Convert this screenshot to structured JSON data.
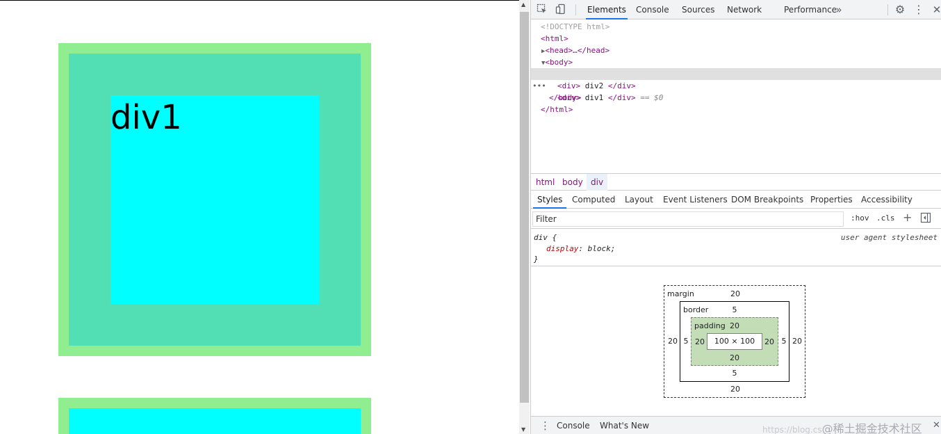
{
  "page": {
    "div1_text": "div1"
  },
  "devtools": {
    "tabs": [
      "Elements",
      "Console",
      "Sources",
      "Network",
      "Performance"
    ],
    "more_tabs_icon": "chevrons-right-icon",
    "elements_tree": {
      "doctype": "<!DOCTYPE html>",
      "html_open": "<html>",
      "head": "<head>…</head>",
      "body_open": "<body>",
      "div1_open": "<div>",
      "div1_text": " div1 ",
      "div1_close": "</div>",
      "div1_marker": "== $0",
      "div2_open": "<div>",
      "div2_text": " div2 ",
      "div2_close": "</div>",
      "body_close": "</body>",
      "html_close": "</html>",
      "row_menu": "•••"
    },
    "breadcrumbs": [
      "html",
      "body",
      "div"
    ],
    "subtabs": [
      "Styles",
      "Computed",
      "Layout",
      "Event Listeners",
      "DOM Breakpoints",
      "Properties",
      "Accessibility"
    ],
    "filter": {
      "placeholder": "Filter",
      "hov": ":hov",
      "cls": ".cls",
      "add_icon": "plus-icon",
      "toggle_icon": "sidebar-toggle-icon"
    },
    "style_rule": {
      "selector": "div {",
      "property": "display",
      "value": "block;",
      "close": "}",
      "origin": "user agent stylesheet"
    },
    "box_model": {
      "margin_label": "margin",
      "border_label": "border",
      "padding_label": "padding",
      "margin_top": "20",
      "margin_bottom": "20",
      "margin_left": "20",
      "margin_right": "20",
      "border_top": "5",
      "border_bottom": "5",
      "border_left": "5",
      "border_right": "5",
      "padding_top": "20",
      "padding_bottom": "20",
      "padding_left": "20",
      "padding_right": "20",
      "content": "100 × 100"
    },
    "drawer": {
      "menu_icon": "kebab-menu-icon",
      "tabs": [
        "Console",
        "What's New"
      ],
      "watermark": "@稀土掘金技术社区",
      "watermark_url": "https://blog.cs",
      "close_icon": "close-icon"
    }
  }
}
